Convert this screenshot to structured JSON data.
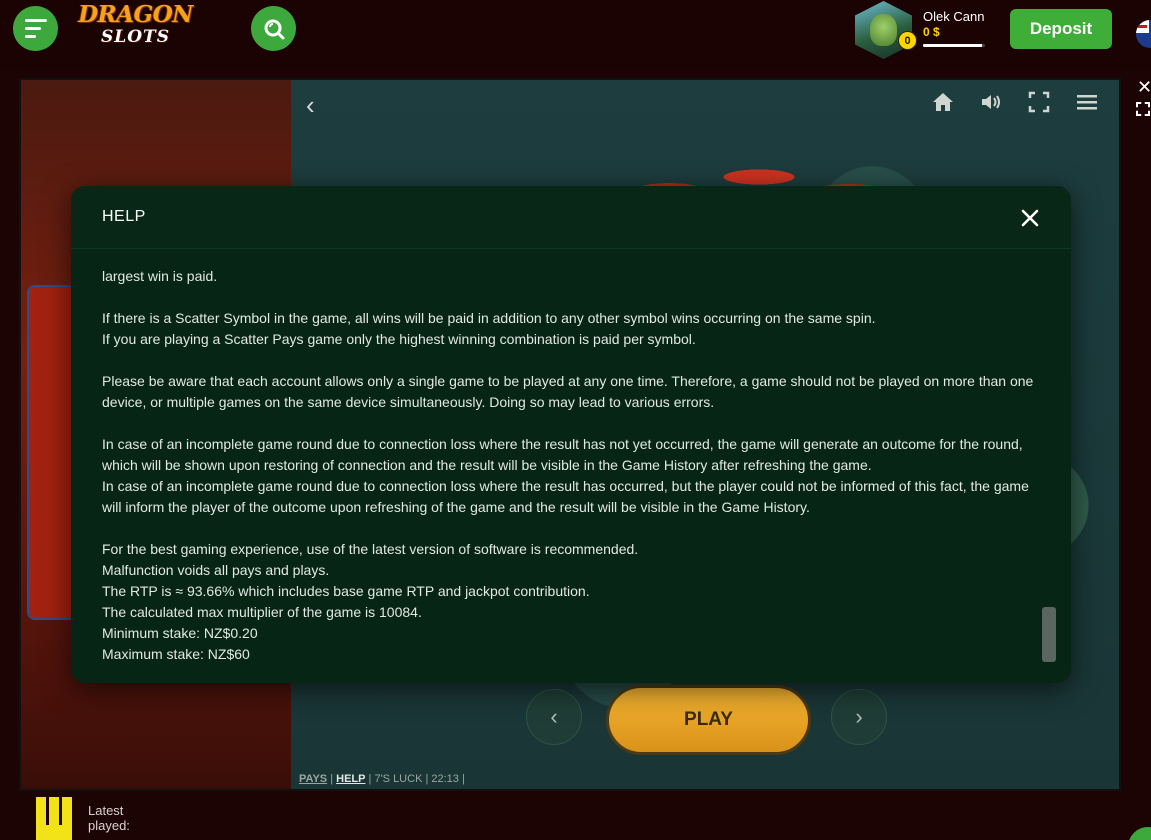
{
  "header": {
    "logo_line1": "DRAGON",
    "logo_line2": "SLOTS",
    "user": {
      "name": "Olek Cann",
      "balance": "0 $",
      "level": "0",
      "progress_fraction": 0.95
    },
    "deposit_label": "Deposit",
    "accent_color": "#3da83b"
  },
  "game": {
    "play_label": "PLAY",
    "status": {
      "pays": "PAYS",
      "help": "HELP",
      "game_name": "7'S LUCK",
      "time": "22:13"
    }
  },
  "modal": {
    "title": "HELP",
    "paragraphs": [
      [
        "largest win is paid."
      ],
      [
        "If there is a Scatter Symbol in the game, all wins will be paid in addition to any other symbol wins occurring on the same spin.",
        "If you are playing a Scatter Pays game only the highest winning combination is paid per symbol."
      ],
      [
        "Please be aware that each account allows only a single game to be played at any one time. Therefore, a game should not be played on more than one device, or multiple games on the same device simultaneously. Doing so may lead to various errors."
      ],
      [
        "In case of an incomplete game round due to connection loss where the result has not yet occurred, the game will generate an outcome for the round, which will be shown upon restoring of connection and the result will be visible in the Game History after refreshing the game.",
        "In case of an incomplete game round due to connection loss where the result has occurred, but the player could not be informed of this fact, the game will inform the player of the outcome upon refreshing of the game and the result will be visible in the Game History."
      ],
      [
        "For the best gaming experience, use of the latest version of software is recommended.",
        "Malfunction voids all pays and plays.",
        "The RTP is ≈ 93.66% which includes base game RTP and jackpot contribution.",
        "The calculated max multiplier of the game is 10084.",
        "Minimum stake: NZ$0.20",
        "Maximum stake: NZ$60"
      ]
    ]
  },
  "footer": {
    "latest_played_label": "Latest played:"
  }
}
